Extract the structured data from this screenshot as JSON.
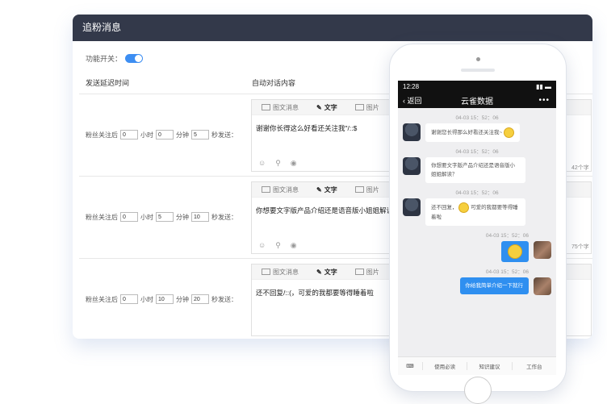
{
  "panel": {
    "title": "追粉消息",
    "toggle_label": "功能开关：",
    "col_delay": "发送延迟时间",
    "col_content": "自动对话内容"
  },
  "rows": [
    {
      "prefix": "粉丝关注后",
      "hours": "0",
      "hour_label": "小时",
      "minutes": "0",
      "minute_label": "分钟",
      "seconds": "5",
      "send_label": "秒发送：",
      "tool_news": "图文消息",
      "tool_text": "文字",
      "tool_image": "图片",
      "content": "谢谢你长得这么好看还关注我\"/::$",
      "count": "42个字"
    },
    {
      "prefix": "粉丝关注后",
      "hours": "0",
      "hour_label": "小时",
      "minutes": "5",
      "minute_label": "分钟",
      "seconds": "10",
      "send_label": "秒发送：",
      "tool_news": "图文消息",
      "tool_text": "文字",
      "tool_image": "图片",
      "content": "你想要文字版产品介绍还是语音版小姐姐解读",
      "count": "75个字"
    },
    {
      "prefix": "粉丝关注后",
      "hours": "0",
      "hour_label": "小时",
      "minutes": "10",
      "minute_label": "分钟",
      "seconds": "20",
      "send_label": "秒发送：",
      "tool_news": "图文消息",
      "tool_text": "文字",
      "tool_image": "图片",
      "content": "还不回复/::(，可爱的我都要等得睡着啦",
      "count": ""
    }
  ],
  "phone": {
    "time": "12:28",
    "back": "返回",
    "title": "云雀数据",
    "more": "•••",
    "messages": [
      {
        "time": "04-03 15：52：06",
        "text": "谢谢您长得那么好看还关注我~"
      },
      {
        "time": "04-03 15：52：06",
        "text": "你想要文字版产品介绍还是语音版小姐姐解读？"
      },
      {
        "time": "04-03 15：52：06",
        "text_a": "还不回复，",
        "text_b": "可爱的我都要等得睡着啦"
      },
      {
        "time": "04-03 15：52：06"
      },
      {
        "time": "04-03 15：52：06",
        "text": "你给我简单介绍一下就行"
      }
    ],
    "menu": [
      "使用必读",
      "知识建议",
      "工作台"
    ]
  }
}
